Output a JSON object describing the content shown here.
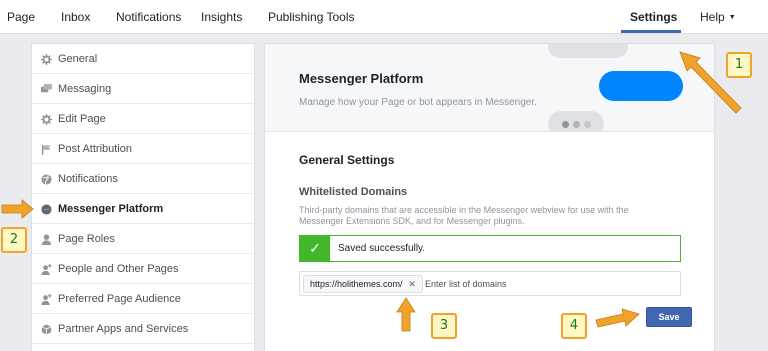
{
  "topnav": {
    "page": "Page",
    "inbox": "Inbox",
    "notifications": "Notifications",
    "insights": "Insights",
    "publishing_tools": "Publishing Tools",
    "settings": "Settings",
    "help": "Help"
  },
  "sidebar": {
    "items": [
      {
        "label": "General",
        "icon": "gear-icon"
      },
      {
        "label": "Messaging",
        "icon": "messages-icon"
      },
      {
        "label": "Edit Page",
        "icon": "gear-icon"
      },
      {
        "label": "Post Attribution",
        "icon": "flag-icon"
      },
      {
        "label": "Notifications",
        "icon": "globe-icon"
      },
      {
        "label": "Messenger Platform",
        "icon": "messenger-icon"
      },
      {
        "label": "Page Roles",
        "icon": "person-icon"
      },
      {
        "label": "People and Other Pages",
        "icon": "person-add-icon"
      },
      {
        "label": "Preferred Page Audience",
        "icon": "person-add-icon"
      },
      {
        "label": "Partner Apps and Services",
        "icon": "cube-icon"
      }
    ]
  },
  "hero": {
    "title": "Messenger Platform",
    "subtitle": "Manage how your Page or bot appears in Messenger."
  },
  "general": {
    "title": "General Settings",
    "whitelist_title": "Whitelisted Domains",
    "description": "Third-party domains that are accessible in the Messenger webview for use with the Messenger Extensions SDK, and for Messenger plugins.",
    "success_message": "Saved successfully.",
    "domain_token": "https://holithemes.com/",
    "domain_placeholder": "Enter list of domains",
    "save_label": "Save"
  },
  "callouts": {
    "one": "1",
    "two": "2",
    "three": "3",
    "four": "4"
  },
  "colors": {
    "accent": "#4267b2",
    "messenger_blue": "#0084ff",
    "success_green": "#42b72a",
    "callout_border": "#f0a22b",
    "callout_fill": "#fff8c4"
  }
}
